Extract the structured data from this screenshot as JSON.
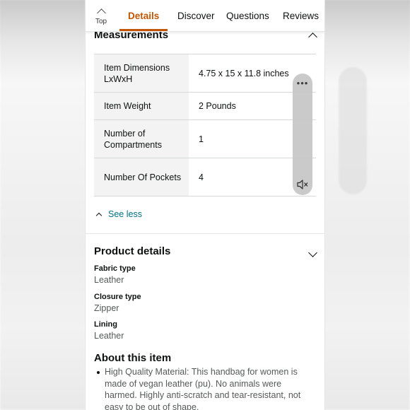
{
  "tabs": {
    "top_label": "Top",
    "items": [
      {
        "label": "Details",
        "active": true
      },
      {
        "label": "Discover",
        "active": false
      },
      {
        "label": "Questions",
        "active": false
      },
      {
        "label": "Reviews",
        "active": false
      }
    ]
  },
  "measurements": {
    "title": "Measurements",
    "rows": [
      {
        "key": "Item Dimensions LxWxH",
        "value": "4.75 x 15 x 11.8 inches"
      },
      {
        "key": "Item Weight",
        "value": "2 Pounds"
      },
      {
        "key": "Number of Compartments",
        "value": "1"
      },
      {
        "key": "Number Of Pockets",
        "value": "4"
      }
    ],
    "see_less": "See less"
  },
  "product_details": {
    "title": "Product details",
    "attributes": [
      {
        "key": "Fabric type",
        "value": "Leather"
      },
      {
        "key": "Closure type",
        "value": "Zipper"
      },
      {
        "key": "Lining",
        "value": "Leather"
      }
    ]
  },
  "about": {
    "title": "About this item",
    "bullets": [
      "High Quality Material: This handbag for women is made of vegan leather (pu). No animals were harmed. Highly anti-scratch and tear-resistant, not easy to be out of shape."
    ]
  },
  "float_control": {
    "menu_icon": "more-dots-icon",
    "mute_icon": "speaker-muted-icon"
  },
  "colors": {
    "accent": "#c45500",
    "link": "#007185",
    "text": "#0f1111",
    "muted": "#565959"
  }
}
